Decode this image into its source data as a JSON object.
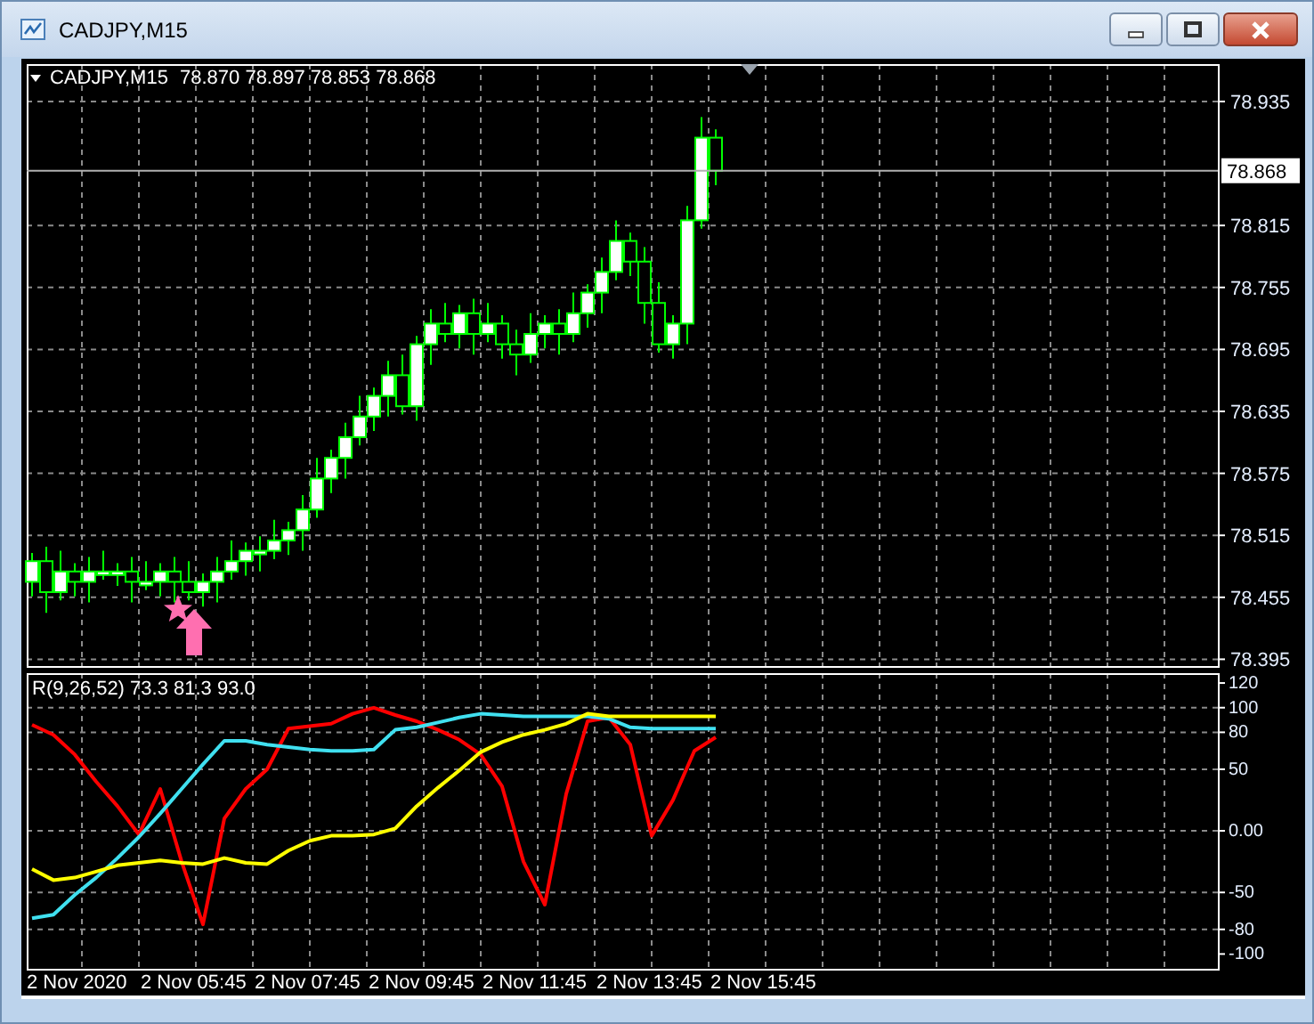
{
  "window": {
    "title": "CADJPY,M15"
  },
  "chart": {
    "symbol": "CADJPY,M15",
    "ohlc": "78.870 78.897 78.853 78.868",
    "price_axis": [
      "78.935",
      "78.815",
      "78.755",
      "78.695",
      "78.635",
      "78.575",
      "78.515",
      "78.455",
      "78.395"
    ],
    "current_price": "78.868",
    "time_axis": [
      "2 Nov 2020",
      "2 Nov 05:45",
      "2 Nov 07:45",
      "2 Nov 09:45",
      "2 Nov 11:45",
      "2 Nov 13:45",
      "2 Nov 15:45"
    ]
  },
  "indicator": {
    "label": "R(9,26,52) 73.3 81.3 93.0",
    "chart_data": {
      "type": "line",
      "grid": true,
      "ylim": [
        -112,
        128
      ],
      "yticks": [
        120,
        100,
        80,
        50,
        {
          "value": 0,
          "label": "0.00"
        },
        -50,
        -80,
        -100
      ],
      "series": [
        {
          "color": "#ff0000",
          "values": [
            86,
            78,
            62,
            40,
            20,
            -3,
            34,
            -25,
            -76,
            10,
            34,
            50,
            83,
            85,
            87,
            95,
            100,
            94,
            89,
            82,
            74,
            62,
            36,
            -25,
            -60,
            30,
            89,
            92,
            70,
            -4,
            25,
            65,
            76
          ]
        },
        {
          "color": "#40e0f0",
          "values": [
            -71,
            -68,
            -52,
            -38,
            -22,
            -5,
            14,
            34,
            54,
            73,
            73,
            70,
            68,
            66,
            65,
            65,
            66,
            82,
            84,
            88,
            92,
            95,
            94,
            93,
            93,
            93,
            93,
            91,
            84,
            83,
            83,
            83,
            83
          ]
        },
        {
          "color": "#ffff00",
          "values": [
            -31,
            -40,
            -38,
            -33,
            -28,
            -26,
            -24,
            -26,
            -27,
            -22,
            -26,
            -27,
            -16,
            -8,
            -4,
            -4,
            -3,
            2,
            20,
            35,
            49,
            64,
            72,
            78,
            82,
            87,
            95,
            93,
            93,
            93,
            93,
            93,
            93
          ]
        }
      ]
    }
  }
}
